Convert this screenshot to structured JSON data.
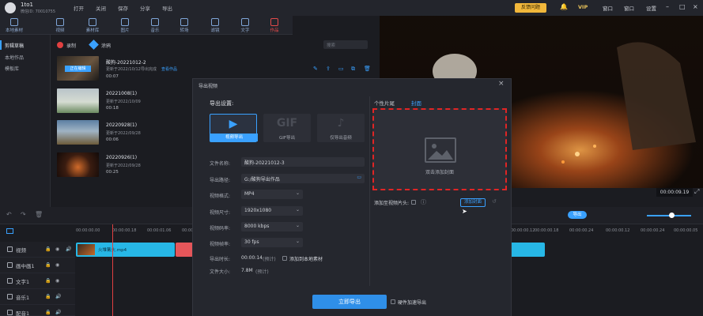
{
  "user": {
    "name": "1to1",
    "id": "微信ID: 70010755"
  },
  "menu": [
    "打开",
    "关闭",
    "保存",
    "分享",
    "导出"
  ],
  "topbar": {
    "feedback": "反馈问题",
    "vip": "VIP",
    "window_label": "窗口",
    "settings_label": "设置"
  },
  "tools": [
    {
      "label": "本地素材",
      "icon": "folder-icon"
    },
    {
      "label": "视频",
      "icon": "video-icon"
    },
    {
      "label": "素材库",
      "icon": "library-icon"
    },
    {
      "label": "图片",
      "icon": "image-icon"
    },
    {
      "label": "音乐",
      "icon": "music-icon"
    },
    {
      "label": "转场",
      "icon": "transition-icon"
    },
    {
      "label": "滤镜",
      "icon": "filter-icon"
    },
    {
      "label": "文字",
      "icon": "text-icon"
    },
    {
      "label": "作品",
      "icon": "works-icon"
    }
  ],
  "leftnav": [
    "剪辑草稿",
    "本地作品",
    "模板库"
  ],
  "media": {
    "record_label": "录制",
    "paint_label": "涂鸦",
    "search_placeholder": "搜索",
    "items": [
      {
        "title": "酸狗-20221012-2",
        "date": "更新于2022/10/12",
        "status": "导出完成",
        "link": "查看作品",
        "duration": "00:07",
        "badge": "正在编辑"
      },
      {
        "title": "20221008(1)",
        "date": "更新于2022/10/09",
        "duration": "00:18"
      },
      {
        "title": "20220928(1)",
        "date": "更新于2022/09/28",
        "duration": "00:06"
      },
      {
        "title": "20220926(1)",
        "date": "更新于2022/09/28",
        "duration": "00:25"
      }
    ]
  },
  "preview": {
    "time": "00:00:09.19"
  },
  "timeline": {
    "ruler": [
      "00:00:00.00",
      "00:00:00.18",
      "00:00:01.06",
      "00:00:00.24",
      "00:00:00.12",
      "00:00:00.18",
      "00:00:00.24",
      "00:00:00.12",
      "00:00:00.24",
      "00:00:00.05",
      "00:00:00.18",
      "00:00:00.12"
    ],
    "tracks": [
      "视频",
      "画中画1",
      "文字1",
      "音乐1",
      "配音1"
    ],
    "clip_label": "火堆篝火.mp4"
  },
  "export_dialog": {
    "title": "导出视频",
    "section_title": "导出设置:",
    "formats": [
      {
        "big": "▶",
        "label": "视频导出"
      },
      {
        "big": "GIF",
        "label": "GIF导出"
      },
      {
        "big": "♪",
        "label": "仅导出音频"
      }
    ],
    "fields": {
      "filename_label": "文件名称:",
      "filename": "酸狗-20221012-3",
      "path_label": "导出路径:",
      "path": "G:/酸狗导出作品",
      "format_label": "视频格式:",
      "format": "MP4",
      "size_label": "视频尺寸:",
      "size": "1920x1080",
      "bitrate_label": "视频码率:",
      "bitrate": "8000 kbps",
      "fps_label": "视频帧率:",
      "fps": "30 fps",
      "duration_label": "导出时长:",
      "duration": "00:00:14",
      "duration_note": "(预计)",
      "add_local_label": "添加到本地素材",
      "filesize_label": "文件大小:",
      "filesize": "7.8M",
      "filesize_note": "(预计)"
    },
    "tabs": [
      "个性片尾",
      "封面"
    ],
    "cover_hint": "双击添加封面",
    "add_to_head_label": "添加至视频片头:",
    "add_cover_button": "添加封面",
    "export_button": "立即导出",
    "hw_accel_label": "硬件加速导出"
  }
}
